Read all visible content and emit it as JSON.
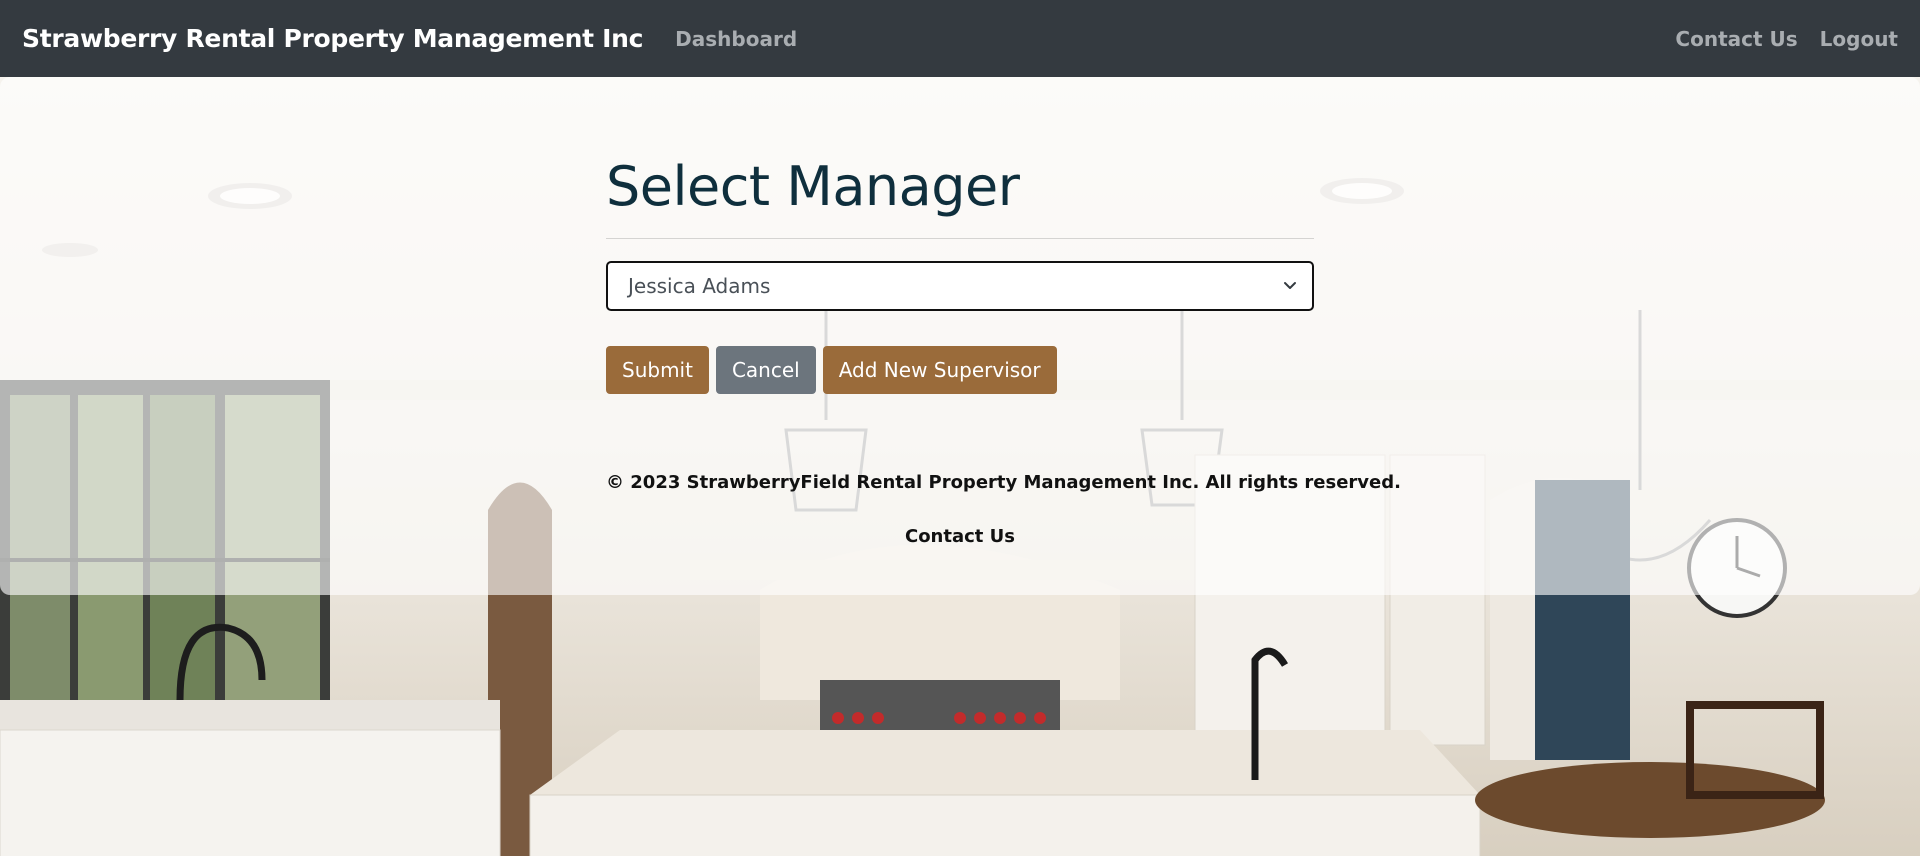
{
  "navbar": {
    "brand": "Strawberry Rental Property Management Inc",
    "links": {
      "dashboard": "Dashboard",
      "contact": "Contact Us",
      "logout": "Logout"
    },
    "background_color": "#343a40"
  },
  "main": {
    "title": "Select Manager",
    "manager_select": {
      "selected_value": "Jessica Adams"
    },
    "buttons": {
      "submit": "Submit",
      "cancel": "Cancel",
      "add_supervisor": "Add New Supervisor"
    },
    "accent_color": "#9a6b3a",
    "secondary_color": "#6c757d"
  },
  "footer": {
    "copyright": "© 2023 StrawberryField Rental Property Management Inc. All rights reserved.",
    "contact": "Contact Us"
  },
  "background": {
    "icon": "kitchen-photo"
  }
}
